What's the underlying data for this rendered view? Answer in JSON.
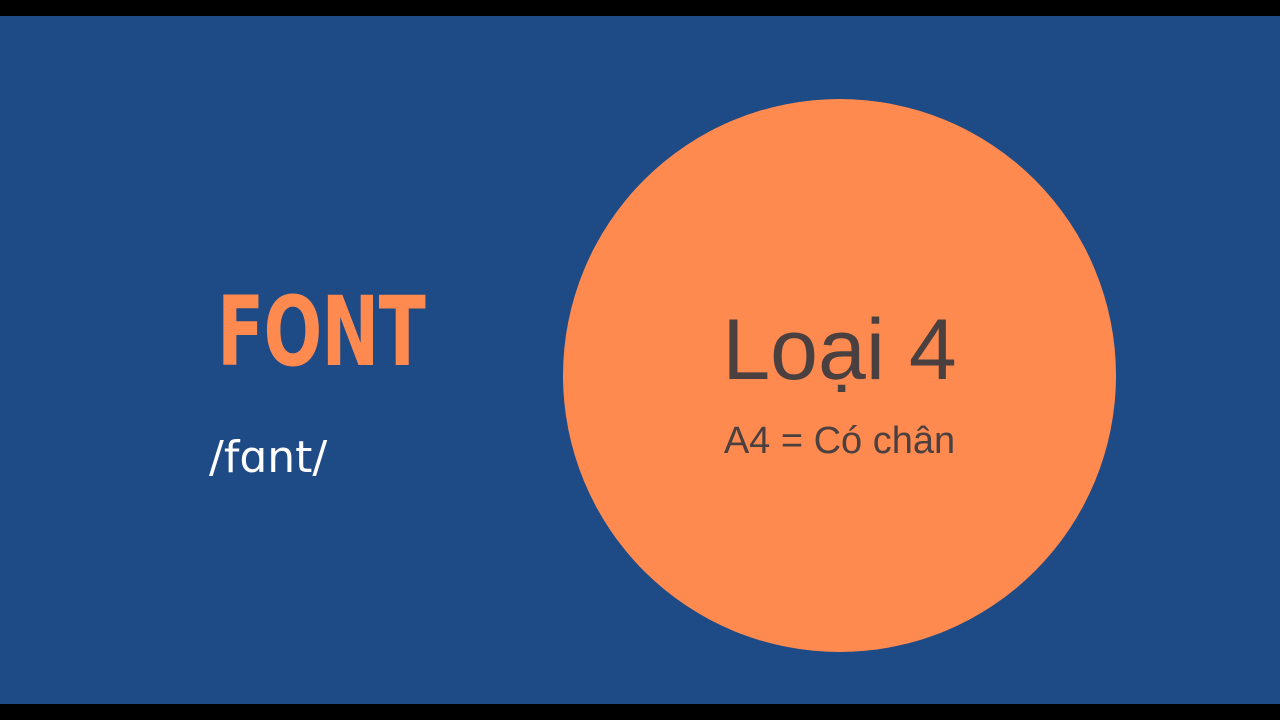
{
  "slide": {
    "word": "FONT",
    "phonetic": "/fɑnt/",
    "circle": {
      "title": "Loại 4",
      "subtitle": "A4 = Có chân"
    }
  },
  "colors": {
    "background": "#1e4a85",
    "letterbox": "#000000",
    "accent": "#ff8a50",
    "phonetic_text": "#ffffff",
    "circle_text": "#4a4040"
  }
}
